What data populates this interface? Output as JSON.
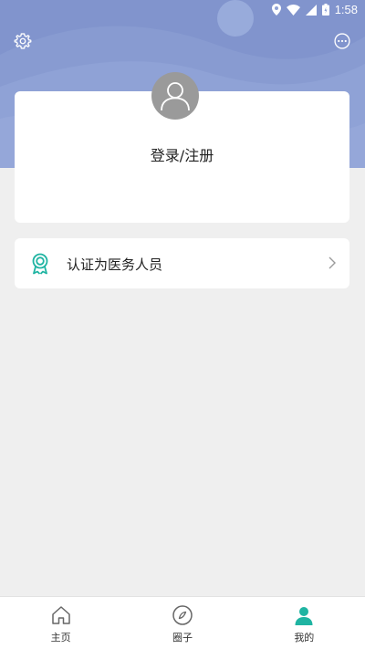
{
  "status_bar": {
    "time": "1:58"
  },
  "header": {
    "settings_icon": "gear-icon",
    "more_icon": "chat-more-icon"
  },
  "profile": {
    "avatar_icon": "user-avatar-icon",
    "login_label": "登录/注册"
  },
  "certification": {
    "icon": "award-badge-icon",
    "label": "认证为医务人员",
    "chevron": "chevron-right-icon"
  },
  "tabs": [
    {
      "label": "主页",
      "icon": "home-icon",
      "active": false
    },
    {
      "label": "圈子",
      "icon": "compass-icon",
      "active": false
    },
    {
      "label": "我的",
      "icon": "person-icon",
      "active": true
    }
  ],
  "colors": {
    "header": "#8fa2d6",
    "accent": "#1fb4a2",
    "background": "#efefef"
  }
}
